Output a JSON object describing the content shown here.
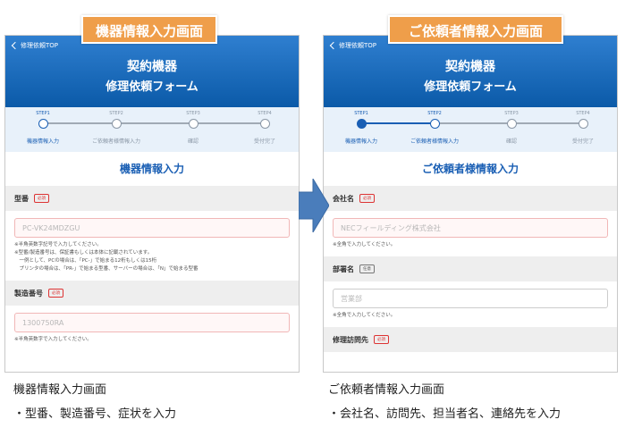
{
  "colors": {
    "header_blue": "#0b5aa8",
    "accent_blue": "#1a5fb4",
    "banner_orange": "#ef9e4a",
    "required_red": "#dd3333",
    "arrow_blue": "#4a7dbb"
  },
  "screen1": {
    "banner": "機器情報入力画面",
    "back_label": "修理依頼TOP",
    "header": {
      "line1": "契約機器",
      "line2": "修理依頼フォーム"
    },
    "steps": [
      {
        "num": "STEP1",
        "label": "機器情報入力"
      },
      {
        "num": "STEP2",
        "label": "ご依頼者様情報入力"
      },
      {
        "num": "STEP3",
        "label": "確認"
      },
      {
        "num": "STEP4",
        "label": "受付完了"
      }
    ],
    "current_step": 1,
    "section_title": "機器情報入力",
    "fields": [
      {
        "label": "型番",
        "badge": "必須",
        "placeholder": "PC-VK24MDZGU",
        "notes": [
          "※半角英数字記号で入力してください。",
          "※型番/製造番号は、保証書もしくは本体に記載されています。",
          "　一例として、PCの場合は、「PC-」で始まる12桁もしくは15桁",
          "　プリンタの場合は、「PR-」で始まる型番、サーバーの場合は、「N」で始まる型番"
        ]
      },
      {
        "label": "製造番号",
        "badge": "必須",
        "placeholder": "1300750RA",
        "notes": [
          "※半角英数字で入力してください。"
        ]
      }
    ],
    "caption_title": "機器情報入力画面",
    "caption_sub": "・型番、製造番号、症状を入力"
  },
  "screen2": {
    "banner": "ご依頼者情報入力画面",
    "back_label": "修理依頼TOP",
    "header": {
      "line1": "契約機器",
      "line2": "修理依頼フォーム"
    },
    "steps": [
      {
        "num": "STEP1",
        "label": "機器情報入力"
      },
      {
        "num": "STEP2",
        "label": "ご依頼者様情報入力"
      },
      {
        "num": "STEP3",
        "label": "確認"
      },
      {
        "num": "STEP4",
        "label": "受付完了"
      }
    ],
    "current_step": 2,
    "section_title": "ご依頼者様情報入力",
    "fields": [
      {
        "label": "会社名",
        "badge": "必須",
        "placeholder": "NECフィールディング株式会社",
        "notes": [
          "※全角で入力してください。"
        ]
      },
      {
        "label": "部署名",
        "badge": "任意",
        "placeholder": "営業部",
        "notes": [
          "※全角で入力してください。"
        ]
      },
      {
        "label": "修理訪問先",
        "badge": "必須"
      }
    ],
    "caption_title": "ご依頼者情報入力画面",
    "caption_sub": "・会社名、訪問先、担当者名、連絡先を入力"
  }
}
